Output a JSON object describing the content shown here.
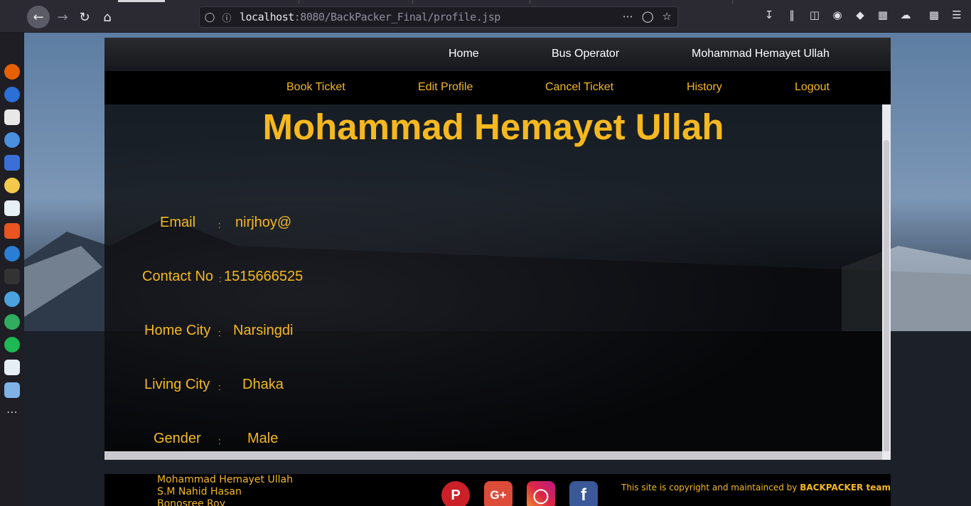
{
  "browser": {
    "url_host": "localhost",
    "url_port": ":8080",
    "url_path": "/BackPacker_Final/profile.jsp"
  },
  "nav_top": {
    "home": "Home",
    "bus_operator": "Bus Operator",
    "user_name": "Mohammad Hemayet Ullah"
  },
  "nav_bottom": {
    "book_ticket": "Book Ticket",
    "edit_profile": "Edit Profile",
    "cancel_ticket": "Cancel Ticket",
    "history": "History",
    "logout": "Logout"
  },
  "profile": {
    "name": "Mohammad Hemayet Ullah",
    "separator": ":",
    "fields": [
      {
        "label": "Email",
        "value": "nirjhoy@"
      },
      {
        "label": "Contact No",
        "value": "1515666525"
      },
      {
        "label": "Home City",
        "value": "Narsingdi"
      },
      {
        "label": "Living City",
        "value": "Dhaka"
      },
      {
        "label": "Gender",
        "value": "Male"
      }
    ]
  },
  "footer": {
    "credits": [
      "Mohammad Hemayet Ullah",
      "S.M Nahid Hasan",
      "Bonosree Roy"
    ],
    "copyright_prefix": "This site is copyright and maintainced by",
    "copyright_team": "BACKPACKER team",
    "social_icons": [
      "pinterest-icon",
      "google-plus-icon",
      "instagram-icon",
      "facebook-icon"
    ]
  },
  "colors": {
    "accent": "#f5b81f",
    "nav_bg": "#000000"
  }
}
